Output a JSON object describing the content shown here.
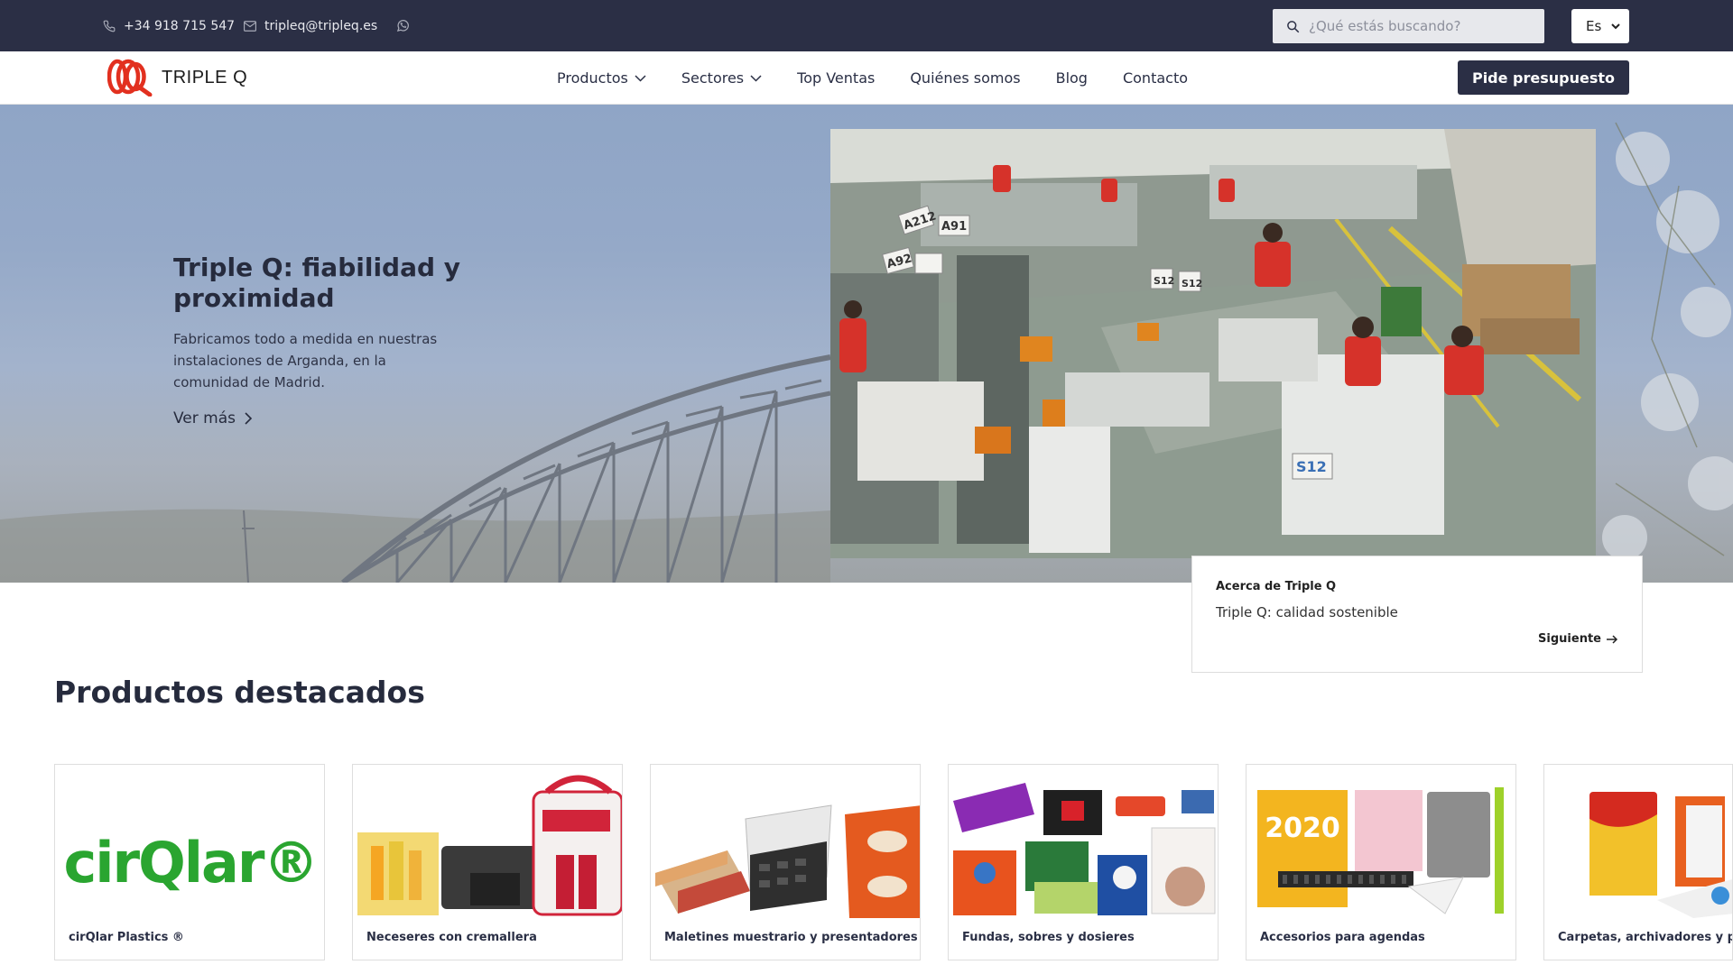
{
  "topbar": {
    "phone": "+34 918 715 547",
    "email": "tripleq@tripleq.es",
    "search_placeholder": "¿Qué estás buscando?",
    "language": "Es"
  },
  "nav": {
    "brand": "TRIPLE Q",
    "links": [
      "Productos",
      "Sectores",
      "Top Ventas",
      "Quiénes somos",
      "Blog",
      "Contacto"
    ],
    "cta": "Pide presupuesto"
  },
  "hero": {
    "title": "Triple Q: fiabilidad y proximidad",
    "description": "Fabricamos todo a medida en nuestras instalaciones de Arganda, en la comunidad de Madrid.",
    "more": "Ver más",
    "video_labels": [
      "A212",
      "A91",
      "A92",
      "S12",
      "S12",
      "S12"
    ]
  },
  "about": {
    "label": "Acerca de Triple Q",
    "title": "Triple Q: calidad sostenible",
    "next": "Siguiente"
  },
  "products": {
    "title": "Productos destacados",
    "items": [
      {
        "label": "cirQlar Plastics ®",
        "logo_text": "cirQlar®"
      },
      {
        "label": "Neceseres con cremallera"
      },
      {
        "label": "Maletines muestrario y presentadores"
      },
      {
        "label": "Fundas, sobres y dosieres"
      },
      {
        "label": "Accesorios para agendas",
        "image_text": "2020"
      },
      {
        "label": "Carpetas, archivadores y po"
      }
    ]
  },
  "colors": {
    "dark_navy": "#2b2f45",
    "brand_red": "#e2301f",
    "cirqlar_green": "#2aa530"
  }
}
